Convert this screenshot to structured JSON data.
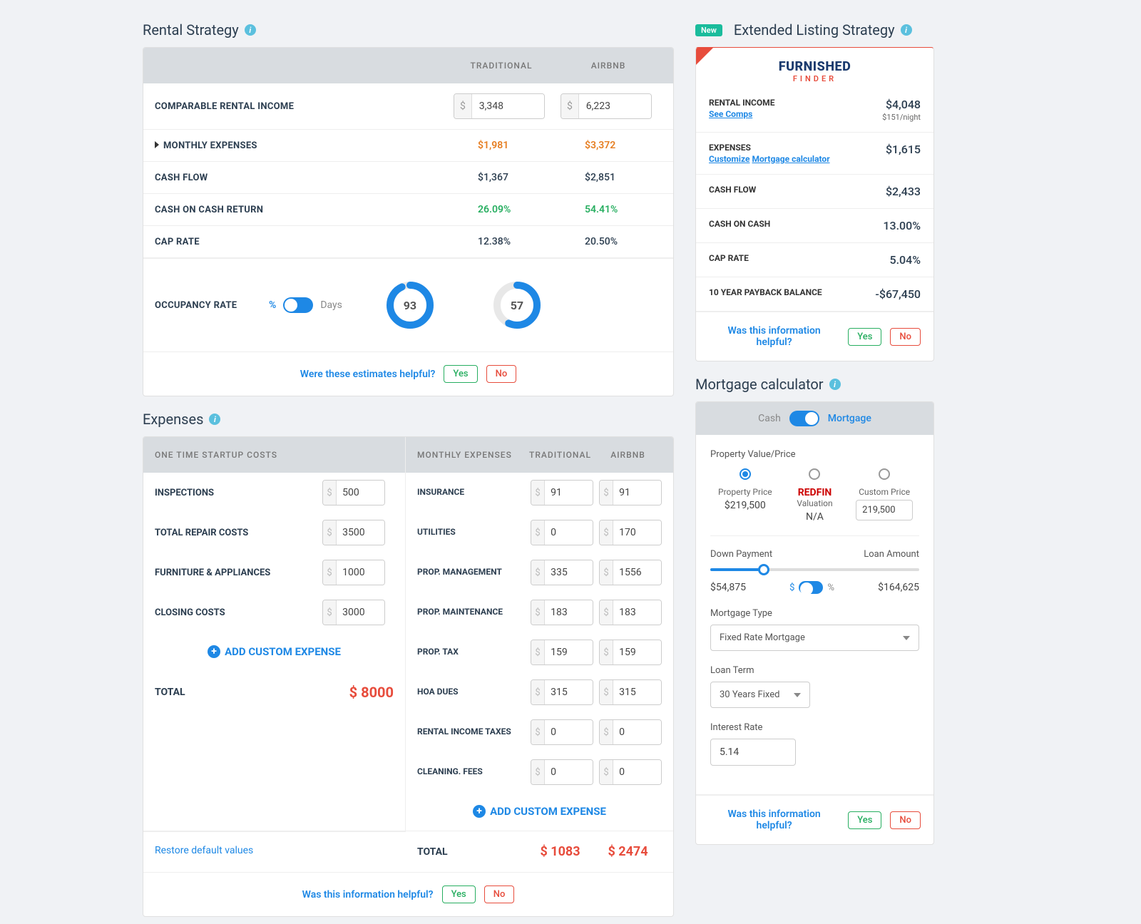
{
  "rental": {
    "title": "Rental Strategy",
    "cols": {
      "trad": "TRADITIONAL",
      "airbnb": "AIRBNB"
    },
    "rows": {
      "income": {
        "label": "COMPARABLE RENTAL INCOME",
        "trad": "3,348",
        "airbnb": "6,223"
      },
      "expenses": {
        "label": "MONTHLY EXPENSES",
        "trad": "$1,981",
        "airbnb": "$3,372"
      },
      "cashflow": {
        "label": "CASH FLOW",
        "trad": "$1,367",
        "airbnb": "$2,851"
      },
      "coc": {
        "label": "CASH ON CASH RETURN",
        "trad": "26.09%",
        "airbnb": "54.41%"
      },
      "cap": {
        "label": "CAP RATE",
        "trad": "12.38%",
        "airbnb": "20.50%"
      }
    },
    "occupancy": {
      "label": "OCCUPANCY RATE",
      "percent": "%",
      "days": "Days",
      "trad": "93",
      "airbnb": "57"
    },
    "helpful": {
      "text": "Were these estimates helpful?",
      "yes": "Yes",
      "no": "No"
    }
  },
  "extended": {
    "badge": "New",
    "title": "Extended Listing Strategy",
    "logo": "FURNISHED",
    "logoSub": "FINDER",
    "rows": {
      "income": {
        "label": "RENTAL INCOME",
        "value": "$4,048",
        "night": "$151/night",
        "link": "See Comps"
      },
      "expenses": {
        "label": "EXPENSES",
        "value": "$1,615",
        "link1": "Customize",
        "link2": "Mortgage calculator"
      },
      "cashflow": {
        "label": "CASH FLOW",
        "value": "$2,433"
      },
      "coc": {
        "label": "CASH ON CASH",
        "value": "13.00%"
      },
      "cap": {
        "label": "CAP RATE",
        "value": "5.04%"
      },
      "payback": {
        "label": "10 YEAR PAYBACK BALANCE",
        "value": "-$67,450"
      }
    },
    "helpful": {
      "text": "Was this information helpful?",
      "yes": "Yes",
      "no": "No"
    }
  },
  "expenses": {
    "title": "Expenses",
    "startup": {
      "header": "ONE TIME STARTUP COSTS",
      "inspections": {
        "label": "INSPECTIONS",
        "value": "500"
      },
      "repair": {
        "label": "TOTAL REPAIR COSTS",
        "value": "3500"
      },
      "furniture": {
        "label": "FURNITURE & APPLIANCES",
        "value": "1000"
      },
      "closing": {
        "label": "CLOSING COSTS",
        "value": "3000"
      },
      "add": "ADD CUSTOM EXPENSE",
      "total": {
        "label": "TOTAL",
        "value": "$ 8000"
      }
    },
    "monthly": {
      "h1": "MONTHLY EXPENSES",
      "h2": "TRADITIONAL",
      "h3": "AIRBNB",
      "insurance": {
        "label": "INSURANCE",
        "trad": "91",
        "airbnb": "91"
      },
      "utilities": {
        "label": "UTILITIES",
        "trad": "0",
        "airbnb": "170"
      },
      "mgmt": {
        "label": "PROP. MANAGEMENT",
        "trad": "335",
        "airbnb": "1556"
      },
      "maint": {
        "label": "PROP. MAINTENANCE",
        "trad": "183",
        "airbnb": "183"
      },
      "tax": {
        "label": "PROP. TAX",
        "trad": "159",
        "airbnb": "159"
      },
      "hoa": {
        "label": "HOA DUES",
        "trad": "315",
        "airbnb": "315"
      },
      "rtax": {
        "label": "RENTAL INCOME TAXES",
        "trad": "0",
        "airbnb": "0"
      },
      "clean": {
        "label": "CLEANING. FEES",
        "trad": "0",
        "airbnb": "0"
      },
      "add": "ADD CUSTOM EXPENSE",
      "total": {
        "label": "TOTAL",
        "trad": "$ 1083",
        "airbnb": "$ 2474"
      }
    },
    "restore": "Restore default values",
    "helpful": {
      "text": "Was this information helpful?",
      "yes": "Yes",
      "no": "No"
    }
  },
  "mortgage": {
    "title": "Mortgage calculator",
    "togCash": "Cash",
    "togMort": "Mortgage",
    "propLabel": "Property Value/Price",
    "opts": {
      "pp": {
        "label": "Property Price",
        "value": "$219,500"
      },
      "redfin": {
        "label": "REDFIN",
        "sub": "Valuation",
        "value": "N/A"
      },
      "custom": {
        "label": "Custom Price",
        "value": "219,500"
      }
    },
    "dp": {
      "label": "Down Payment",
      "loan": "Loan Amount",
      "dpVal": "$54,875",
      "loanVal": "$164,625",
      "dollar": "$",
      "pct": "%"
    },
    "type": {
      "label": "Mortgage Type",
      "value": "Fixed Rate Mortgage"
    },
    "term": {
      "label": "Loan Term",
      "value": "30 Years Fixed"
    },
    "rate": {
      "label": "Interest Rate",
      "value": "5.14"
    },
    "helpful": {
      "text": "Was this information helpful?",
      "yes": "Yes",
      "no": "No"
    }
  }
}
